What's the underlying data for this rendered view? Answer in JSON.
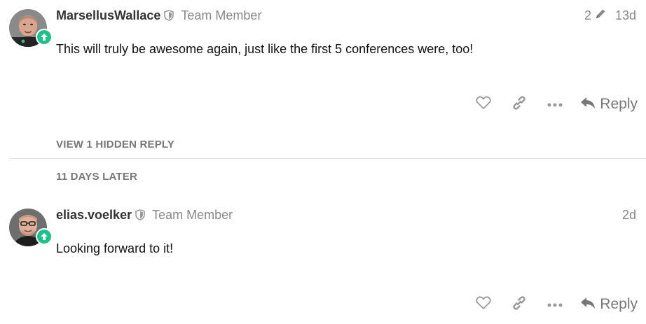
{
  "posts": [
    {
      "username": "MarsellusWallace",
      "user_title": "Team Member",
      "edit_count": "2",
      "timestamp": "13d",
      "body": "This will truly be awesome again, just like the first 5 conferences were, too!",
      "reply_label": "Reply",
      "shield_icon": "shield-icon",
      "flair_icon": "arrow-up-flair-icon"
    },
    {
      "username": "elias.voelker",
      "user_title": "Team Member",
      "timestamp": "2d",
      "body": "Looking forward to it!",
      "reply_label": "Reply",
      "shield_icon": "shield-icon",
      "flair_icon": "arrow-up-flair-icon"
    }
  ],
  "hidden_replies_label": "VIEW 1 HIDDEN REPLY",
  "time_gap_label": "11 DAYS LATER",
  "icons": {
    "like": "heart-icon",
    "link": "link-icon",
    "more": "more-dots-icon",
    "reply": "reply-arrow-icon",
    "edit": "pencil-icon"
  },
  "colors": {
    "flair": "#1fc08a",
    "icon_gray": "#999999",
    "meta_gray": "#888888",
    "divider": "#e5e5e5"
  }
}
